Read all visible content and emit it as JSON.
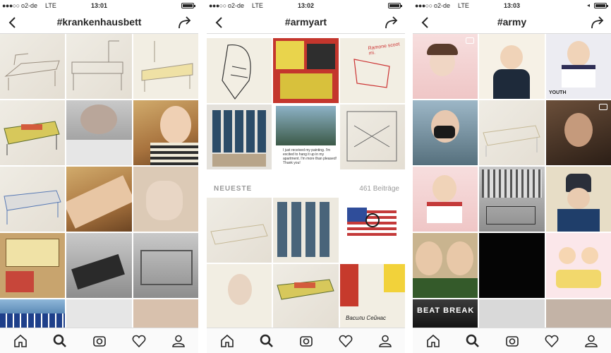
{
  "screens": [
    {
      "status": {
        "signal": "●●●○○",
        "carrier": "o2-de",
        "network": "LTE",
        "time": "13:01"
      },
      "title": "#krankenhausbett"
    },
    {
      "status": {
        "signal": "●●●○○",
        "carrier": "o2-de",
        "network": "LTE",
        "time": "13:02"
      },
      "title": "#armyart",
      "section": {
        "label": "NEUESTE",
        "count": "461 Beiträge"
      },
      "caption": "I just received my painting. I'm excited to hang it up in my apartment. I'm more than pleased! Thank you!",
      "painting_text": "Васили Сейнас",
      "note_text": "Ramone scoot mi."
    },
    {
      "status": {
        "signal": "●●●○○",
        "carrier": "o2-de",
        "network": "LTE",
        "time": "13:03",
        "location": "◂"
      },
      "title": "#army",
      "tile_texts": {
        "youth": "YOUTH",
        "beat_break": "BEAT BREAK"
      }
    }
  ],
  "icons": {
    "back": "chevron-left-icon",
    "share": "share-arrow-icon",
    "tabs": [
      "home-icon",
      "search-icon",
      "camera-icon",
      "heart-icon",
      "profile-icon"
    ]
  },
  "colors": {
    "accent": "#262626",
    "divider": "#dbdbdb",
    "muted": "#999999"
  }
}
